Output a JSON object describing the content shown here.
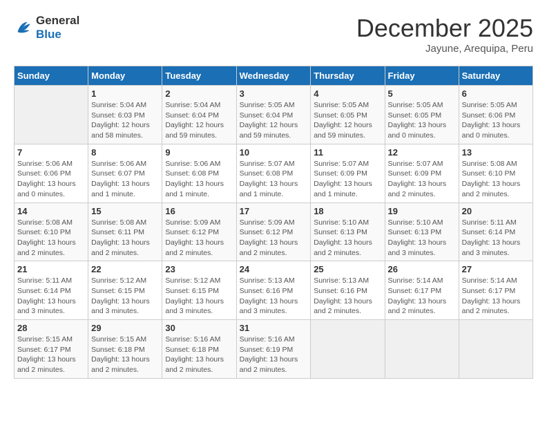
{
  "header": {
    "logo_general": "General",
    "logo_blue": "Blue",
    "month_title": "December 2025",
    "location": "Jayune, Arequipa, Peru"
  },
  "weekdays": [
    "Sunday",
    "Monday",
    "Tuesday",
    "Wednesday",
    "Thursday",
    "Friday",
    "Saturday"
  ],
  "weeks": [
    [
      {
        "day": "",
        "info": ""
      },
      {
        "day": "1",
        "info": "Sunrise: 5:04 AM\nSunset: 6:03 PM\nDaylight: 12 hours\nand 58 minutes."
      },
      {
        "day": "2",
        "info": "Sunrise: 5:04 AM\nSunset: 6:04 PM\nDaylight: 12 hours\nand 59 minutes."
      },
      {
        "day": "3",
        "info": "Sunrise: 5:05 AM\nSunset: 6:04 PM\nDaylight: 12 hours\nand 59 minutes."
      },
      {
        "day": "4",
        "info": "Sunrise: 5:05 AM\nSunset: 6:05 PM\nDaylight: 12 hours\nand 59 minutes."
      },
      {
        "day": "5",
        "info": "Sunrise: 5:05 AM\nSunset: 6:05 PM\nDaylight: 13 hours\nand 0 minutes."
      },
      {
        "day": "6",
        "info": "Sunrise: 5:05 AM\nSunset: 6:06 PM\nDaylight: 13 hours\nand 0 minutes."
      }
    ],
    [
      {
        "day": "7",
        "info": "Sunrise: 5:06 AM\nSunset: 6:06 PM\nDaylight: 13 hours\nand 0 minutes."
      },
      {
        "day": "8",
        "info": "Sunrise: 5:06 AM\nSunset: 6:07 PM\nDaylight: 13 hours\nand 1 minute."
      },
      {
        "day": "9",
        "info": "Sunrise: 5:06 AM\nSunset: 6:08 PM\nDaylight: 13 hours\nand 1 minute."
      },
      {
        "day": "10",
        "info": "Sunrise: 5:07 AM\nSunset: 6:08 PM\nDaylight: 13 hours\nand 1 minute."
      },
      {
        "day": "11",
        "info": "Sunrise: 5:07 AM\nSunset: 6:09 PM\nDaylight: 13 hours\nand 1 minute."
      },
      {
        "day": "12",
        "info": "Sunrise: 5:07 AM\nSunset: 6:09 PM\nDaylight: 13 hours\nand 2 minutes."
      },
      {
        "day": "13",
        "info": "Sunrise: 5:08 AM\nSunset: 6:10 PM\nDaylight: 13 hours\nand 2 minutes."
      }
    ],
    [
      {
        "day": "14",
        "info": "Sunrise: 5:08 AM\nSunset: 6:10 PM\nDaylight: 13 hours\nand 2 minutes."
      },
      {
        "day": "15",
        "info": "Sunrise: 5:08 AM\nSunset: 6:11 PM\nDaylight: 13 hours\nand 2 minutes."
      },
      {
        "day": "16",
        "info": "Sunrise: 5:09 AM\nSunset: 6:12 PM\nDaylight: 13 hours\nand 2 minutes."
      },
      {
        "day": "17",
        "info": "Sunrise: 5:09 AM\nSunset: 6:12 PM\nDaylight: 13 hours\nand 2 minutes."
      },
      {
        "day": "18",
        "info": "Sunrise: 5:10 AM\nSunset: 6:13 PM\nDaylight: 13 hours\nand 2 minutes."
      },
      {
        "day": "19",
        "info": "Sunrise: 5:10 AM\nSunset: 6:13 PM\nDaylight: 13 hours\nand 3 minutes."
      },
      {
        "day": "20",
        "info": "Sunrise: 5:11 AM\nSunset: 6:14 PM\nDaylight: 13 hours\nand 3 minutes."
      }
    ],
    [
      {
        "day": "21",
        "info": "Sunrise: 5:11 AM\nSunset: 6:14 PM\nDaylight: 13 hours\nand 3 minutes."
      },
      {
        "day": "22",
        "info": "Sunrise: 5:12 AM\nSunset: 6:15 PM\nDaylight: 13 hours\nand 3 minutes."
      },
      {
        "day": "23",
        "info": "Sunrise: 5:12 AM\nSunset: 6:15 PM\nDaylight: 13 hours\nand 3 minutes."
      },
      {
        "day": "24",
        "info": "Sunrise: 5:13 AM\nSunset: 6:16 PM\nDaylight: 13 hours\nand 3 minutes."
      },
      {
        "day": "25",
        "info": "Sunrise: 5:13 AM\nSunset: 6:16 PM\nDaylight: 13 hours\nand 2 minutes."
      },
      {
        "day": "26",
        "info": "Sunrise: 5:14 AM\nSunset: 6:17 PM\nDaylight: 13 hours\nand 2 minutes."
      },
      {
        "day": "27",
        "info": "Sunrise: 5:14 AM\nSunset: 6:17 PM\nDaylight: 13 hours\nand 2 minutes."
      }
    ],
    [
      {
        "day": "28",
        "info": "Sunrise: 5:15 AM\nSunset: 6:17 PM\nDaylight: 13 hours\nand 2 minutes."
      },
      {
        "day": "29",
        "info": "Sunrise: 5:15 AM\nSunset: 6:18 PM\nDaylight: 13 hours\nand 2 minutes."
      },
      {
        "day": "30",
        "info": "Sunrise: 5:16 AM\nSunset: 6:18 PM\nDaylight: 13 hours\nand 2 minutes."
      },
      {
        "day": "31",
        "info": "Sunrise: 5:16 AM\nSunset: 6:19 PM\nDaylight: 13 hours\nand 2 minutes."
      },
      {
        "day": "",
        "info": ""
      },
      {
        "day": "",
        "info": ""
      },
      {
        "day": "",
        "info": ""
      }
    ]
  ]
}
